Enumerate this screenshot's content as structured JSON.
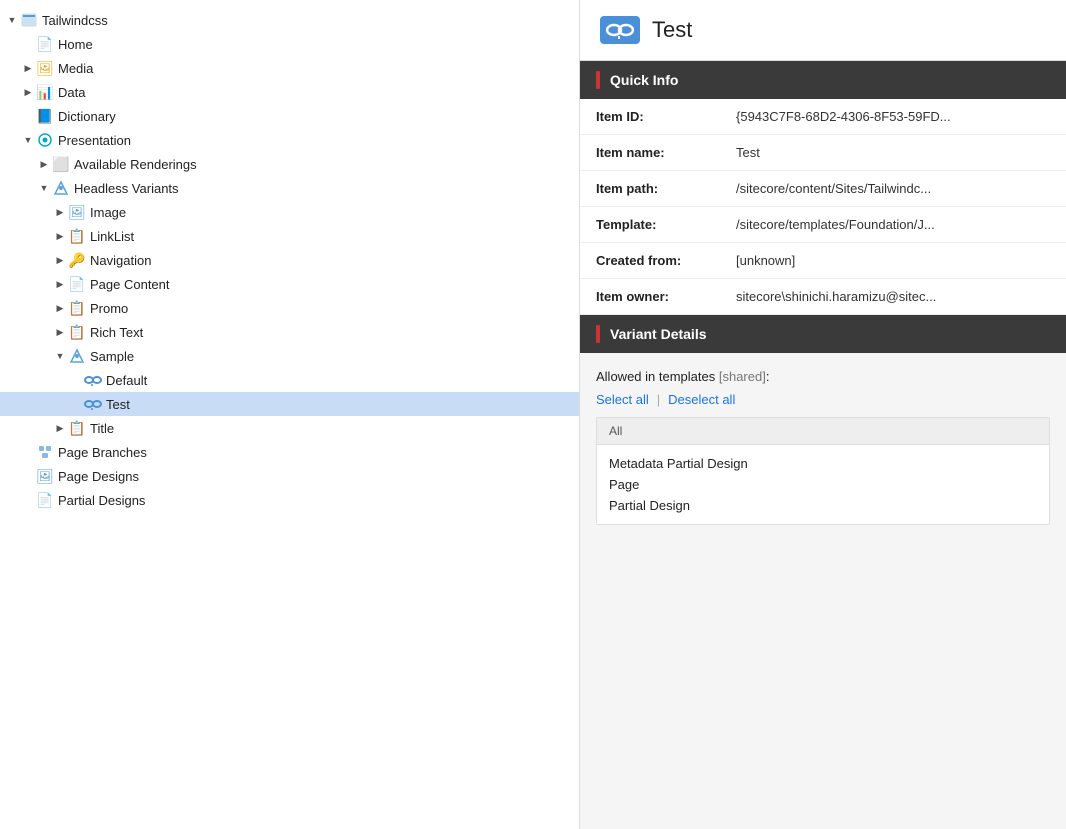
{
  "left_panel": {
    "tree": [
      {
        "id": "tailwindcss",
        "label": "Tailwindcss",
        "indent": 0,
        "toggle": "expanded",
        "icon": "🗃",
        "icon_class": "icon-tailwind"
      },
      {
        "id": "home",
        "label": "Home",
        "indent": 1,
        "toggle": "leaf",
        "icon": "📄",
        "icon_class": "icon-home"
      },
      {
        "id": "media",
        "label": "Media",
        "indent": 1,
        "toggle": "collapsed",
        "icon": "🖼",
        "icon_class": "icon-media"
      },
      {
        "id": "data",
        "label": "Data",
        "indent": 1,
        "toggle": "collapsed",
        "icon": "📊",
        "icon_class": "icon-data"
      },
      {
        "id": "dictionary",
        "label": "Dictionary",
        "indent": 1,
        "toggle": "leaf",
        "icon": "📘",
        "icon_class": "icon-dict"
      },
      {
        "id": "presentation",
        "label": "Presentation",
        "indent": 1,
        "toggle": "expanded",
        "icon": "👁",
        "icon_class": "icon-presentation"
      },
      {
        "id": "available-renderings",
        "label": "Available Renderings",
        "indent": 2,
        "toggle": "collapsed",
        "icon": "⬜",
        "icon_class": "icon-renderings"
      },
      {
        "id": "headless-variants",
        "label": "Headless Variants",
        "indent": 2,
        "toggle": "expanded",
        "icon": "🔷",
        "icon_class": "icon-headless"
      },
      {
        "id": "image",
        "label": "Image",
        "indent": 3,
        "toggle": "collapsed",
        "icon": "🖼",
        "icon_class": "icon-image"
      },
      {
        "id": "linklist",
        "label": "LinkList",
        "indent": 3,
        "toggle": "collapsed",
        "icon": "📋",
        "icon_class": "icon-linklist"
      },
      {
        "id": "navigation",
        "label": "Navigation",
        "indent": 3,
        "toggle": "collapsed",
        "icon": "🔑",
        "icon_class": "icon-navigation"
      },
      {
        "id": "page-content",
        "label": "Page Content",
        "indent": 3,
        "toggle": "collapsed",
        "icon": "📄",
        "icon_class": "icon-pagecontent"
      },
      {
        "id": "promo",
        "label": "Promo",
        "indent": 3,
        "toggle": "collapsed",
        "icon": "📋",
        "icon_class": "icon-promo"
      },
      {
        "id": "rich-text",
        "label": "Rich Text",
        "indent": 3,
        "toggle": "collapsed",
        "icon": "📋",
        "icon_class": "icon-richtext"
      },
      {
        "id": "sample",
        "label": "Sample",
        "indent": 3,
        "toggle": "expanded",
        "icon": "🔷",
        "icon_class": "icon-sample"
      },
      {
        "id": "default",
        "label": "Default",
        "indent": 4,
        "toggle": "leaf",
        "icon": "👓",
        "icon_class": "icon-default"
      },
      {
        "id": "test",
        "label": "Test",
        "indent": 4,
        "toggle": "leaf",
        "icon": "👓",
        "icon_class": "icon-test",
        "selected": true
      },
      {
        "id": "title",
        "label": "Title",
        "indent": 3,
        "toggle": "collapsed",
        "icon": "📋",
        "icon_class": "icon-title"
      },
      {
        "id": "page-branches",
        "label": "Page Branches",
        "indent": 1,
        "toggle": "leaf",
        "icon": "⚙",
        "icon_class": "icon-pagebranches"
      },
      {
        "id": "page-designs",
        "label": "Page Designs",
        "indent": 1,
        "toggle": "leaf",
        "icon": "🖼",
        "icon_class": "icon-pagedesigns"
      },
      {
        "id": "partial-designs",
        "label": "Partial Designs",
        "indent": 1,
        "toggle": "leaf",
        "icon": "📄",
        "icon_class": "icon-partialdesigns"
      }
    ]
  },
  "right_panel": {
    "header": {
      "title": "Test",
      "icon_label": "variant-icon"
    },
    "quick_info": {
      "section_title": "Quick Info",
      "fields": [
        {
          "label": "Item ID:",
          "value": "{5943C7F8-68D2-4306-8F53-59FD..."
        },
        {
          "label": "Item name:",
          "value": "Test"
        },
        {
          "label": "Item path:",
          "value": "/sitecore/content/Sites/Tailwindc..."
        },
        {
          "label": "Template:",
          "value": "/sitecore/templates/Foundation/J..."
        },
        {
          "label": "Created from:",
          "value": "[unknown]"
        },
        {
          "label": "Item owner:",
          "value": "sitecore\\shinichi.haramizu@sitec..."
        }
      ]
    },
    "variant_details": {
      "section_title": "Variant Details",
      "allowed_templates_label": "Allowed in templates",
      "shared_tag": "[shared]",
      "select_all_label": "Select all",
      "deselect_all_label": "Deselect all",
      "list_header": "All",
      "templates": [
        {
          "name": "Metadata Partial Design"
        },
        {
          "name": "Page"
        },
        {
          "name": "Partial Design"
        }
      ]
    }
  }
}
